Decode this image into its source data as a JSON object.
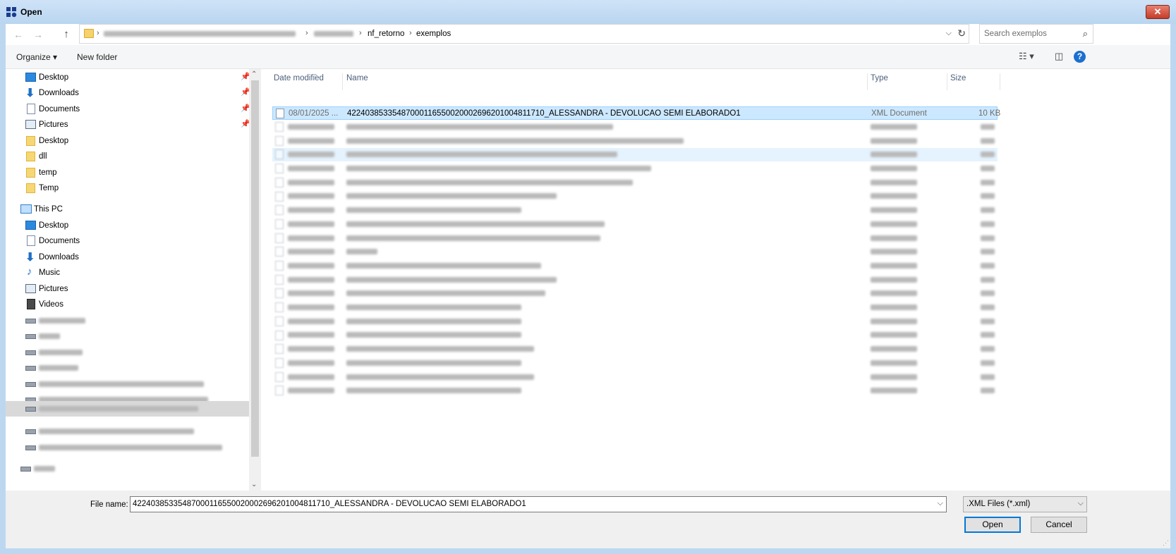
{
  "window": {
    "title": "Open",
    "close_label": "✕"
  },
  "address": {
    "crumbs": [
      "nf_retorno",
      "exemplos"
    ],
    "search_placeholder": "Search exemplos"
  },
  "toolbar": {
    "organize_label": "Organize ▾",
    "new_folder_label": "New folder",
    "help_label": "?"
  },
  "nav": {
    "quick_access": [
      {
        "label": "Desktop",
        "icon": "desktop-icon",
        "pinned": true
      },
      {
        "label": "Downloads",
        "icon": "download-arrow-icon",
        "pinned": true
      },
      {
        "label": "Documents",
        "icon": "documents-icon",
        "pinned": true
      },
      {
        "label": "Pictures",
        "icon": "pictures-icon",
        "pinned": true
      },
      {
        "label": "Desktop",
        "icon": "folder-icon",
        "pinned": false
      },
      {
        "label": "dll",
        "icon": "folder-icon",
        "pinned": false
      },
      {
        "label": "temp",
        "icon": "folder-icon",
        "pinned": false
      },
      {
        "label": "Temp",
        "icon": "folder-icon",
        "pinned": false
      }
    ],
    "this_pc_label": "This PC",
    "this_pc": [
      {
        "label": "Desktop",
        "icon": "desktop-icon"
      },
      {
        "label": "Documents",
        "icon": "documents-icon"
      },
      {
        "label": "Downloads",
        "icon": "download-arrow-icon"
      },
      {
        "label": "Music",
        "icon": "music-icon"
      },
      {
        "label": "Pictures",
        "icon": "pictures-icon"
      },
      {
        "label": "Videos",
        "icon": "videos-icon"
      }
    ]
  },
  "columns": {
    "date": "Date modified",
    "name": "Name",
    "type": "Type",
    "size": "Size"
  },
  "files": [
    {
      "date": "08/01/2025 ...",
      "name": "42240385335487000116550020002696201004811710_ALESSANDRA - DEVOLUCAO SEMI ELABORADO1",
      "type": "XML Document",
      "size": "10 KB",
      "selected": true
    }
  ],
  "bottom": {
    "file_name_label": "File name:",
    "file_name_value": "42240385335487000116550020002696201004811710_ALESSANDRA - DEVOLUCAO SEMI ELABORADO1",
    "file_type_value": ".XML Files (*.xml)",
    "open_label": "Open",
    "cancel_label": "Cancel"
  },
  "colors": {
    "selection": "#cce8ff",
    "selection_border": "#99d1ff",
    "default_button_border": "#0078d7",
    "title_bar": "#bdd7f0"
  }
}
